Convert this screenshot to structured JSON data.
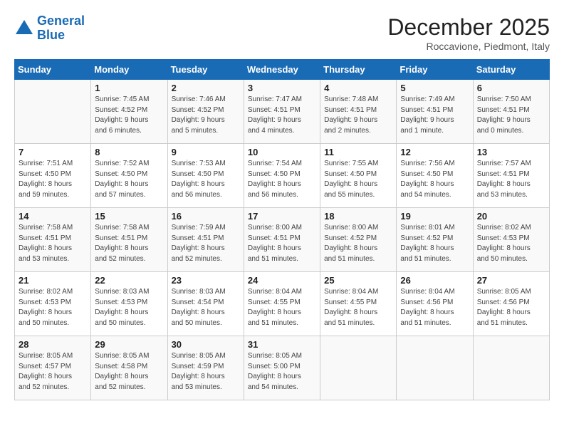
{
  "logo": {
    "line1": "General",
    "line2": "Blue"
  },
  "title": "December 2025",
  "location": "Roccavione, Piedmont, Italy",
  "weekdays": [
    "Sunday",
    "Monday",
    "Tuesday",
    "Wednesday",
    "Thursday",
    "Friday",
    "Saturday"
  ],
  "weeks": [
    [
      {
        "day": "",
        "info": ""
      },
      {
        "day": "1",
        "info": "Sunrise: 7:45 AM\nSunset: 4:52 PM\nDaylight: 9 hours\nand 6 minutes."
      },
      {
        "day": "2",
        "info": "Sunrise: 7:46 AM\nSunset: 4:52 PM\nDaylight: 9 hours\nand 5 minutes."
      },
      {
        "day": "3",
        "info": "Sunrise: 7:47 AM\nSunset: 4:51 PM\nDaylight: 9 hours\nand 4 minutes."
      },
      {
        "day": "4",
        "info": "Sunrise: 7:48 AM\nSunset: 4:51 PM\nDaylight: 9 hours\nand 2 minutes."
      },
      {
        "day": "5",
        "info": "Sunrise: 7:49 AM\nSunset: 4:51 PM\nDaylight: 9 hours\nand 1 minute."
      },
      {
        "day": "6",
        "info": "Sunrise: 7:50 AM\nSunset: 4:51 PM\nDaylight: 9 hours\nand 0 minutes."
      }
    ],
    [
      {
        "day": "7",
        "info": "Sunrise: 7:51 AM\nSunset: 4:50 PM\nDaylight: 8 hours\nand 59 minutes."
      },
      {
        "day": "8",
        "info": "Sunrise: 7:52 AM\nSunset: 4:50 PM\nDaylight: 8 hours\nand 57 minutes."
      },
      {
        "day": "9",
        "info": "Sunrise: 7:53 AM\nSunset: 4:50 PM\nDaylight: 8 hours\nand 56 minutes."
      },
      {
        "day": "10",
        "info": "Sunrise: 7:54 AM\nSunset: 4:50 PM\nDaylight: 8 hours\nand 56 minutes."
      },
      {
        "day": "11",
        "info": "Sunrise: 7:55 AM\nSunset: 4:50 PM\nDaylight: 8 hours\nand 55 minutes."
      },
      {
        "day": "12",
        "info": "Sunrise: 7:56 AM\nSunset: 4:50 PM\nDaylight: 8 hours\nand 54 minutes."
      },
      {
        "day": "13",
        "info": "Sunrise: 7:57 AM\nSunset: 4:51 PM\nDaylight: 8 hours\nand 53 minutes."
      }
    ],
    [
      {
        "day": "14",
        "info": "Sunrise: 7:58 AM\nSunset: 4:51 PM\nDaylight: 8 hours\nand 53 minutes."
      },
      {
        "day": "15",
        "info": "Sunrise: 7:58 AM\nSunset: 4:51 PM\nDaylight: 8 hours\nand 52 minutes."
      },
      {
        "day": "16",
        "info": "Sunrise: 7:59 AM\nSunset: 4:51 PM\nDaylight: 8 hours\nand 52 minutes."
      },
      {
        "day": "17",
        "info": "Sunrise: 8:00 AM\nSunset: 4:51 PM\nDaylight: 8 hours\nand 51 minutes."
      },
      {
        "day": "18",
        "info": "Sunrise: 8:00 AM\nSunset: 4:52 PM\nDaylight: 8 hours\nand 51 minutes."
      },
      {
        "day": "19",
        "info": "Sunrise: 8:01 AM\nSunset: 4:52 PM\nDaylight: 8 hours\nand 51 minutes."
      },
      {
        "day": "20",
        "info": "Sunrise: 8:02 AM\nSunset: 4:53 PM\nDaylight: 8 hours\nand 50 minutes."
      }
    ],
    [
      {
        "day": "21",
        "info": "Sunrise: 8:02 AM\nSunset: 4:53 PM\nDaylight: 8 hours\nand 50 minutes."
      },
      {
        "day": "22",
        "info": "Sunrise: 8:03 AM\nSunset: 4:53 PM\nDaylight: 8 hours\nand 50 minutes."
      },
      {
        "day": "23",
        "info": "Sunrise: 8:03 AM\nSunset: 4:54 PM\nDaylight: 8 hours\nand 50 minutes."
      },
      {
        "day": "24",
        "info": "Sunrise: 8:04 AM\nSunset: 4:55 PM\nDaylight: 8 hours\nand 51 minutes."
      },
      {
        "day": "25",
        "info": "Sunrise: 8:04 AM\nSunset: 4:55 PM\nDaylight: 8 hours\nand 51 minutes."
      },
      {
        "day": "26",
        "info": "Sunrise: 8:04 AM\nSunset: 4:56 PM\nDaylight: 8 hours\nand 51 minutes."
      },
      {
        "day": "27",
        "info": "Sunrise: 8:05 AM\nSunset: 4:56 PM\nDaylight: 8 hours\nand 51 minutes."
      }
    ],
    [
      {
        "day": "28",
        "info": "Sunrise: 8:05 AM\nSunset: 4:57 PM\nDaylight: 8 hours\nand 52 minutes."
      },
      {
        "day": "29",
        "info": "Sunrise: 8:05 AM\nSunset: 4:58 PM\nDaylight: 8 hours\nand 52 minutes."
      },
      {
        "day": "30",
        "info": "Sunrise: 8:05 AM\nSunset: 4:59 PM\nDaylight: 8 hours\nand 53 minutes."
      },
      {
        "day": "31",
        "info": "Sunrise: 8:05 AM\nSunset: 5:00 PM\nDaylight: 8 hours\nand 54 minutes."
      },
      {
        "day": "",
        "info": ""
      },
      {
        "day": "",
        "info": ""
      },
      {
        "day": "",
        "info": ""
      }
    ]
  ]
}
